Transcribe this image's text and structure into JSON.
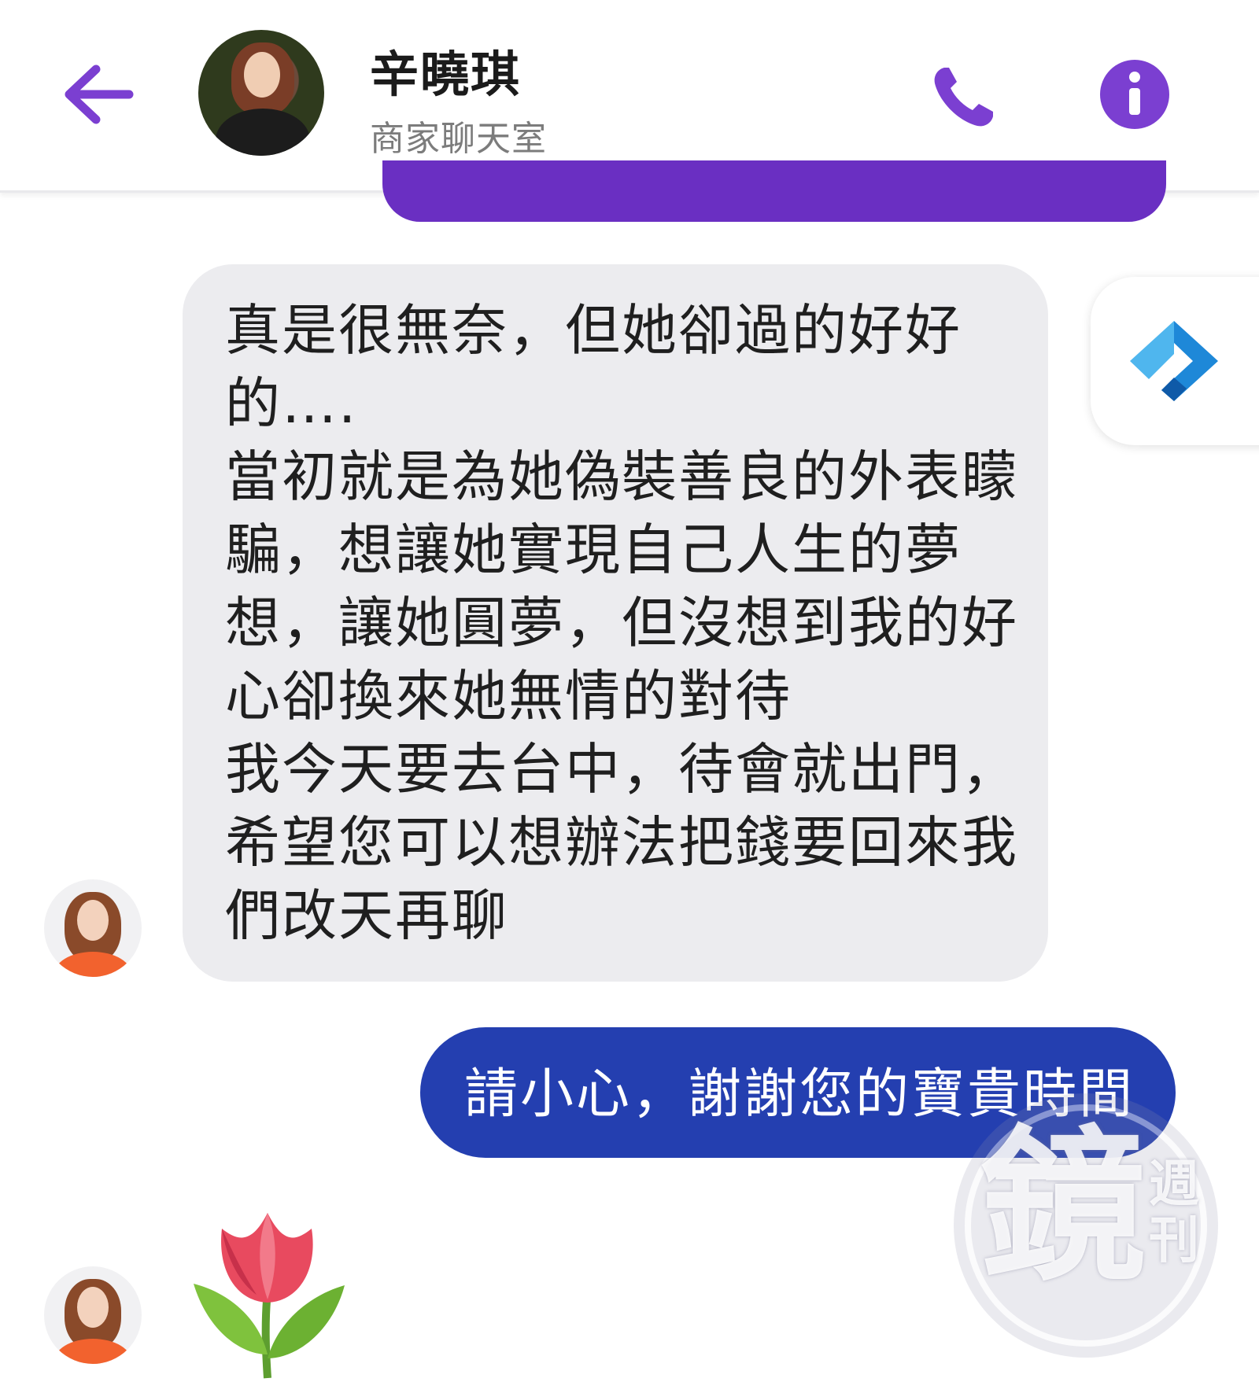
{
  "header": {
    "contact_name": "辛曉琪",
    "contact_subtitle": "商家聊天室",
    "icons": [
      "back-arrow-icon",
      "phone-icon",
      "info-icon"
    ]
  },
  "conversation": {
    "received_message": "真是很無奈，但她卻過的好好\n的….\n當初就是為她偽裝善良的外表矇\n騙，想讓她實現自己人生的夢\n想，讓她圓夢，但沒想到我的好\n心卻換來她無情的對待\n我今天要去台中，待會就出門，\n希望您可以想辦法把錢要回來我\n們改天再聊",
    "sent_message": "請小心，謝謝您的寶貴時間",
    "reaction_emoji": "🌷"
  },
  "watermark": {
    "text_big": "鏡",
    "text_small": "週刊"
  },
  "colors": {
    "accent": "#7b3fd1",
    "received_bubble": "#ececef",
    "sent_bubble": "#243fb0",
    "prev_bubble": "#6a2fc2"
  }
}
